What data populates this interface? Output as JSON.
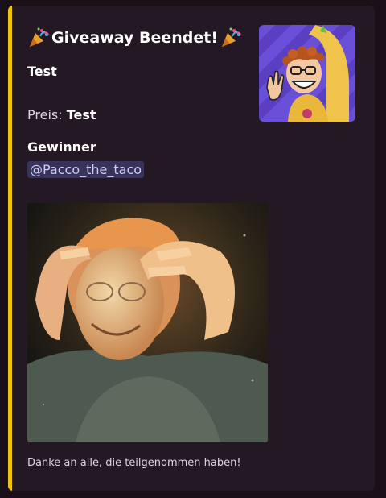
{
  "embed": {
    "accent_color": "#f1c40f",
    "title": "Giveaway Beendet!",
    "title_icon": "party-popper-icon",
    "description": {
      "line1": "Test",
      "prize_label": "Preis:",
      "prize_value": "Test"
    },
    "field": {
      "name": "Gewinner",
      "winner_mention": "@Pacco_the_taco"
    },
    "thumbnail_icon": "taco-avatar",
    "image_icon": "mind-blown-gif",
    "footer_text": "Danke an alle, die teilgenommen haben!"
  }
}
